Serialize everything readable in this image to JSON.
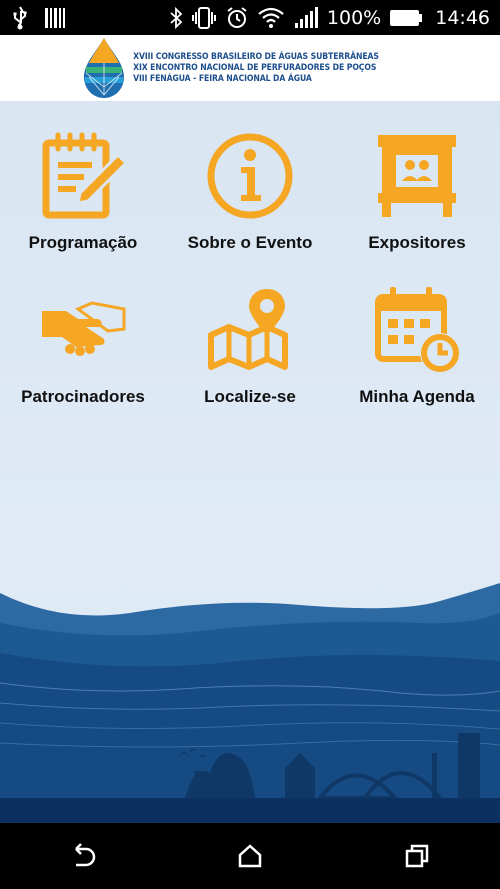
{
  "status_bar": {
    "battery_percent": "100%",
    "time": "14:46",
    "icons": [
      "usb-icon",
      "barcode-icon",
      "bluetooth-icon",
      "vibrate-icon",
      "alarm-icon",
      "wifi-icon",
      "signal-icon",
      "battery-icon"
    ]
  },
  "header": {
    "logo_lines": [
      "XVIII CONGRESSO BRASILEIRO DE ÁGUAS SUBTERRÂNEAS",
      "XIX ENCONTRO NACIONAL DE PERFURADORES DE POÇOS",
      "VIII FENÁGUA - FEIRA NACIONAL DA ÁGUA"
    ]
  },
  "menu": {
    "accent_color": "#f5a623",
    "items": [
      {
        "label": "Programação",
        "icon": "notepad-pencil-icon"
      },
      {
        "label": "Sobre o Evento",
        "icon": "info-icon"
      },
      {
        "label": "Expositores",
        "icon": "booth-people-icon"
      },
      {
        "label": "Patrocinadores",
        "icon": "handshake-icon"
      },
      {
        "label": "Localize-se",
        "icon": "map-pin-icon"
      },
      {
        "label": "Minha Agenda",
        "icon": "calendar-clock-icon"
      }
    ]
  },
  "nav_bar": {
    "icons": [
      "back-icon",
      "home-icon",
      "recent-apps-icon"
    ]
  }
}
